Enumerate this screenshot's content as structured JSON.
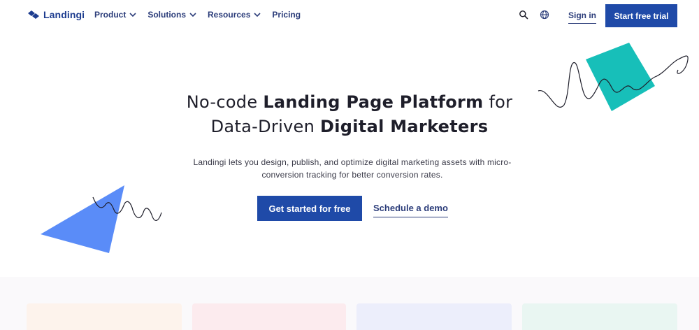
{
  "header": {
    "logo_text": "Landingi",
    "nav": [
      {
        "label": "Product",
        "has_dropdown": true
      },
      {
        "label": "Solutions",
        "has_dropdown": true
      },
      {
        "label": "Resources",
        "has_dropdown": true
      },
      {
        "label": "Pricing",
        "has_dropdown": false
      }
    ],
    "icons": {
      "search": "search-icon",
      "language": "globe-icon"
    },
    "signin_label": "Sign in",
    "trial_label": "Start free trial"
  },
  "hero": {
    "headline_line1_pre": "No-code ",
    "headline_line1_bold": "Landing Page Platform",
    "headline_line1_post": " for",
    "headline_line2_pre": "Data-Driven ",
    "headline_line2_bold": "Digital Marketers",
    "subtext": "Landingi lets you design, publish, and optimize digital marketing assets with micro-conversion tracking for better conversion rates.",
    "cta_primary": "Get started for free",
    "cta_secondary": "Schedule a demo"
  },
  "colors": {
    "brand": "#1f4aa8",
    "nav_text": "#2c3d7a",
    "teal_shape": "#17bfb9",
    "blue_shape": "#5a8cf8"
  }
}
